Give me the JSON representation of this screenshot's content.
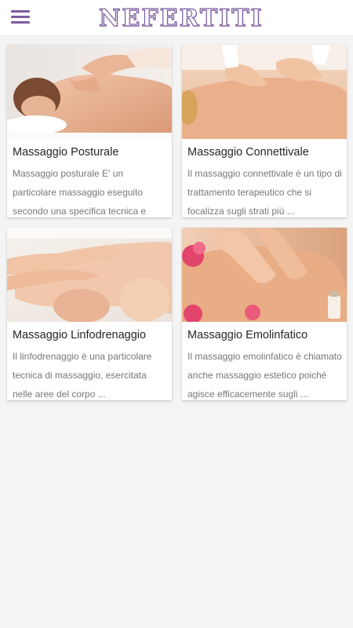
{
  "app": {
    "brand": "NEFERTITI",
    "accent_color": "#7c5c9f",
    "menu_icon": "hamburger-menu-icon"
  },
  "cards": [
    {
      "title": "Massaggio Posturale",
      "description": "Massaggio posturale E' un particolare massaggio eseguito secondo una specifica tecnica e",
      "image": "back-massage-photo"
    },
    {
      "title": "Massaggio Connettivale",
      "description": "Il massaggio connettivale è un tipo di trattamento terapeutico che si focalizza sugli strati più ...",
      "image": "shoulder-massage-photo"
    },
    {
      "title": "Massaggio Linfodrenaggio",
      "description": "Il linfodrenaggio è una particolare tecnica di massaggio, esercitata nelle aree del corpo ...",
      "image": "leg-massage-photo"
    },
    {
      "title": "Massaggio Emolinfatico",
      "description": "Il massaggio emolinfatico è chiamato anche massaggio estetico poiché agisce efficacemente sugli ...",
      "image": "oil-back-massage-photo"
    }
  ]
}
